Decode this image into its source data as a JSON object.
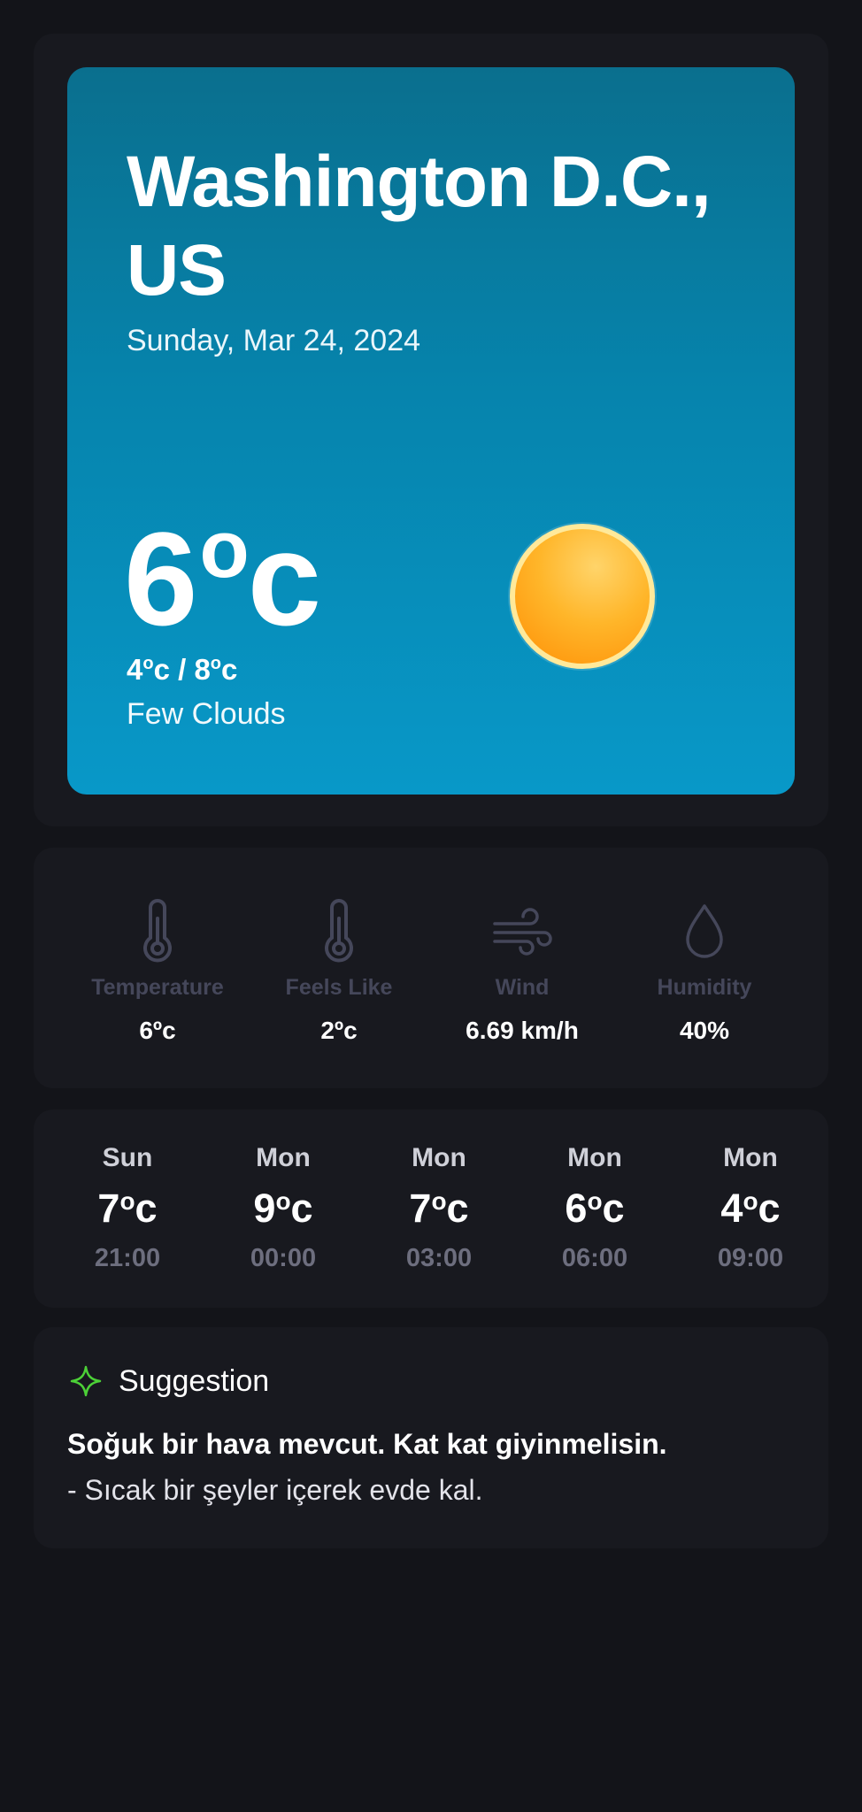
{
  "current": {
    "city": "Washington D.C., US",
    "date": "Sunday, Mar 24, 2024",
    "temp": "6",
    "temp_unit": "o",
    "temp_c": "c",
    "range_low": "4",
    "range_high": "8",
    "range_sep": "c / ",
    "range_end": "c",
    "description": "Few Clouds",
    "icon": "sun-icon"
  },
  "stats": [
    {
      "label": "Temperature",
      "value": "6ºc",
      "icon": "thermometer-icon"
    },
    {
      "label": "Feels Like",
      "value": "2ºc",
      "icon": "thermometer-icon"
    },
    {
      "label": "Wind",
      "value": "6.69 km/h",
      "icon": "wind-icon"
    },
    {
      "label": "Humidity",
      "value": "40%",
      "icon": "droplet-icon"
    }
  ],
  "forecast": [
    {
      "day": "Sun",
      "temp": "7",
      "time": "21:00"
    },
    {
      "day": "Mon",
      "temp": "9",
      "time": "00:00"
    },
    {
      "day": "Mon",
      "temp": "7",
      "time": "03:00"
    },
    {
      "day": "Mon",
      "temp": "6",
      "time": "06:00"
    },
    {
      "day": "Mon",
      "temp": "4",
      "time": "09:00"
    }
  ],
  "forecast_unit": "c",
  "suggestion": {
    "title": "Suggestion",
    "headline": "Soğuk bir hava mevcut. Kat kat giyinmelisin.",
    "detail": "- Sıcak bir şeyler içerek evde kal.",
    "icon": "sparkle-icon",
    "icon_color": "#4cd137"
  },
  "colors": {
    "background": "#131419",
    "panel": "#18191f",
    "hero_top": "#0a6f8e",
    "hero_bottom": "#0898c8",
    "sun": "#ffb62a",
    "muted_label": "#45475a"
  }
}
